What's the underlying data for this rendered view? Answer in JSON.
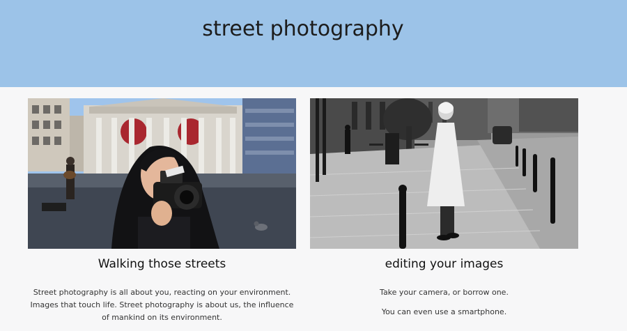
{
  "header": {
    "title": "street photography",
    "background": "#9cc3e8"
  },
  "cards": [
    {
      "title": "Walking those streets",
      "paragraphs": [
        "Street photography is all about you, reacting on your environment. Images that touch life.  Street photography is about us, the influence of mankind on its environment."
      ],
      "image_alt": "Woman holding a camera in a city square"
    },
    {
      "title": "editing your images",
      "paragraphs": [
        "Take your camera, or borrow one.",
        "You can even use a smartphone."
      ],
      "image_alt": "Black and white photo of a man in a white coat on a cobblestone street"
    }
  ]
}
